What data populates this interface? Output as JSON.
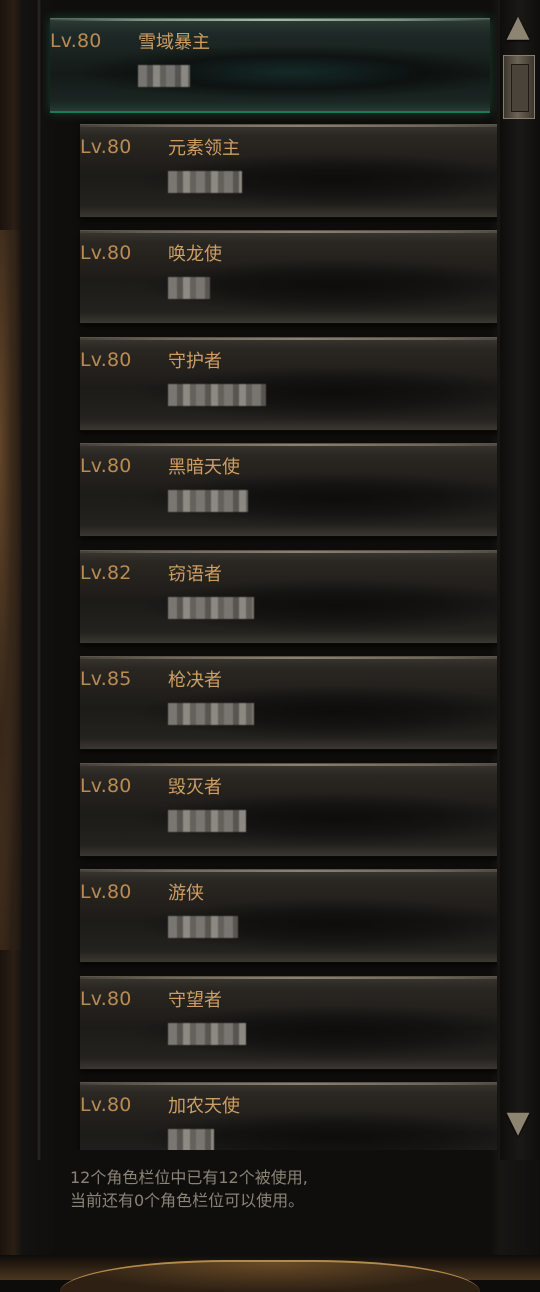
{
  "characters": [
    {
      "level": "Lv.80",
      "class": "雪域暴主",
      "selected": true
    },
    {
      "level": "Lv.80",
      "class": "元素领主"
    },
    {
      "level": "Lv.80",
      "class": "唤龙使"
    },
    {
      "level": "Lv.80",
      "class": "守护者"
    },
    {
      "level": "Lv.80",
      "class": "黑暗天使"
    },
    {
      "level": "Lv.82",
      "class": "窃语者"
    },
    {
      "level": "Lv.85",
      "class": "枪决者"
    },
    {
      "level": "Lv.80",
      "class": "毁灭者"
    },
    {
      "level": "Lv.80",
      "class": "游侠"
    },
    {
      "level": "Lv.80",
      "class": "守望者"
    },
    {
      "level": "Lv.80",
      "class": "加农天使"
    }
  ],
  "info": {
    "line1": "12个角色栏位中已有12个被使用,",
    "line2": "当前还有0个角色栏位可以使用。"
  },
  "scrollbar": {
    "up_icon": "triangle-up-icon",
    "down_icon": "triangle-down-icon",
    "position": 0.0
  },
  "colors": {
    "level_text": "#b98b55",
    "class_text": "#cf9e63",
    "selected_glow": "#1a7a5a"
  }
}
